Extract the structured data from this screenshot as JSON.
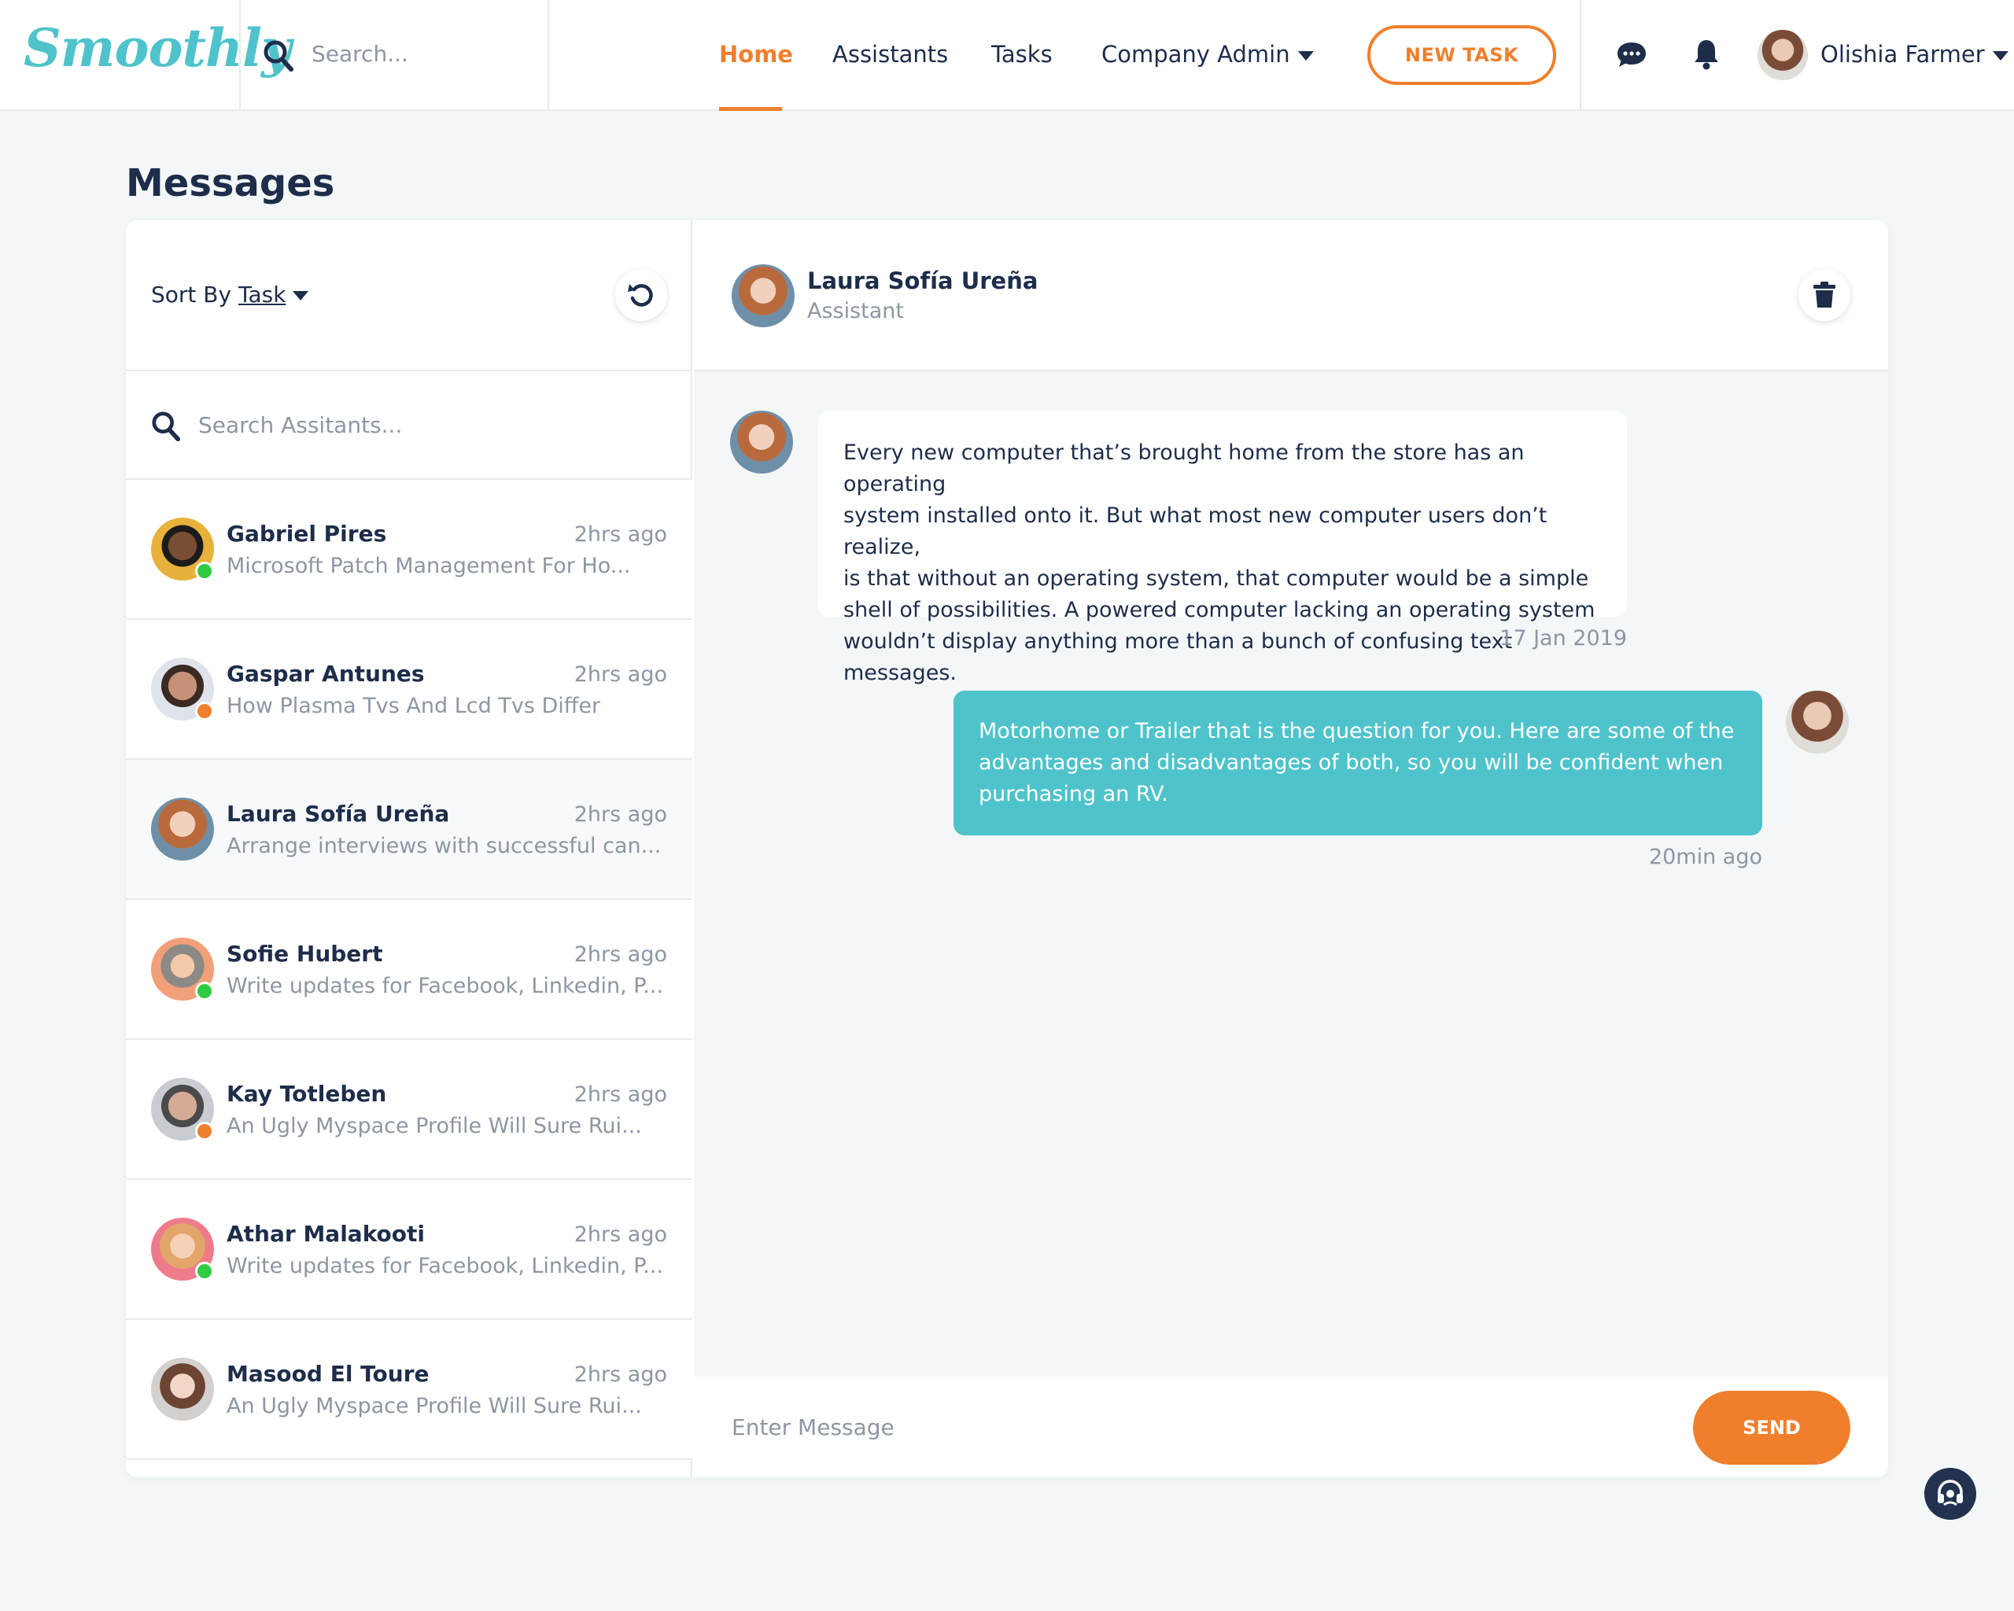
{
  "brand": {
    "logo": "Smoothly",
    "accent": "#4fc3cb",
    "orange": "#f07f2c",
    "navy": "#1d2d4a"
  },
  "topbar": {
    "search_placeholder": "Search...",
    "nav": {
      "home": "Home",
      "assistants": "Assistants",
      "tasks": "Tasks",
      "company_admin": "Company Admin"
    },
    "new_task": "NEW TASK",
    "user_name": "Olishia Farmer"
  },
  "page": {
    "title": "Messages"
  },
  "sidebar": {
    "sort_prefix": "Sort By",
    "sort_value": "Task",
    "search_placeholder": "Search Assitants...",
    "items": [
      {
        "name": "Gabriel Pires",
        "time": "2hrs ago",
        "preview": "Microsoft Patch Management For Ho...",
        "status": "online",
        "status_color": "#2ecc40"
      },
      {
        "name": "Gaspar Antunes",
        "time": "2hrs ago",
        "preview": "How Plasma Tvs And Lcd Tvs Differ",
        "status": "away",
        "status_color": "#f07f2c"
      },
      {
        "name": "Laura Sofía Ureña",
        "time": "2hrs ago",
        "preview": "Arrange interviews with successful can...",
        "status": "none",
        "status_color": ""
      },
      {
        "name": "Sofie Hubert",
        "time": "2hrs ago",
        "preview": "Write updates for Facebook, Linkedin, P...",
        "status": "online",
        "status_color": "#2ecc40"
      },
      {
        "name": "Kay Totleben",
        "time": "2hrs ago",
        "preview": "An Ugly Myspace Profile Will Sure Rui...",
        "status": "away",
        "status_color": "#f07f2c"
      },
      {
        "name": "Athar Malakooti",
        "time": "2hrs ago",
        "preview": "Write updates for Facebook, Linkedin, P...",
        "status": "online",
        "status_color": "#2ecc40"
      },
      {
        "name": "Masood El Toure",
        "time": "2hrs ago",
        "preview": "An Ugly Myspace Profile Will Sure Rui...",
        "status": "none",
        "status_color": ""
      }
    ]
  },
  "chat": {
    "contact_name": "Laura Sofía Ureña",
    "contact_role": "Assistant",
    "messages": [
      {
        "direction": "incoming",
        "lines": [
          "Every new computer that’s brought home from the store has an operating",
          "system installed onto it. But what most new computer users don’t realize,",
          "is that without an operating system, that computer would be a simple",
          "shell of possibilities. A powered computer lacking an operating system",
          "wouldn’t display anything more than a bunch of confusing text messages."
        ],
        "time": "17 Jan 2019"
      },
      {
        "direction": "outgoing",
        "lines": [
          "Motorhome or Trailer that is the question for you. Here are some of the",
          "advantages and disadvantages of both, so you will be confident when",
          "purchasing an RV."
        ],
        "time": "20min ago"
      }
    ],
    "composer_placeholder": "Enter Message",
    "send_label": "SEND"
  }
}
